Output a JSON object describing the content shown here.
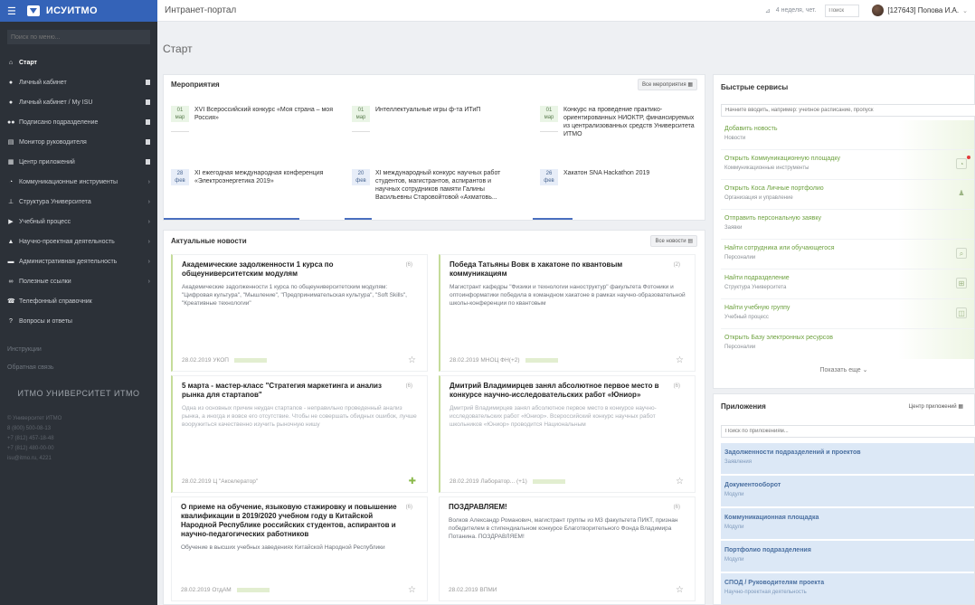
{
  "sidebar": {
    "brand": "ИСУИТМО",
    "search_placeholder": "Поиск по меню...",
    "items": [
      {
        "label": "Старт",
        "active": true,
        "icon": "home-icon"
      },
      {
        "label": "Личный кабинет",
        "icon": "user-icon"
      },
      {
        "label": "Личный кабинет / My ISU",
        "icon": "user-icon"
      },
      {
        "label": "Подписано подразделение",
        "icon": "people-icon"
      },
      {
        "label": "Монитор руководителя",
        "icon": "monitor-icon"
      },
      {
        "label": "Центр приложений",
        "icon": "grid-icon"
      },
      {
        "label": "Коммуникационные инструменты",
        "icon": "chat-icon"
      },
      {
        "label": "Структура Университета",
        "icon": "sitemap-icon"
      },
      {
        "label": "Учебный процесс",
        "icon": "flag-icon"
      },
      {
        "label": "Научно-проектная деятельность",
        "icon": "flask-icon"
      },
      {
        "label": "Административная деятельность",
        "icon": "briefcase-icon"
      },
      {
        "label": "Полезные ссылки",
        "icon": "link-icon"
      },
      {
        "label": "Телефонный справочник",
        "icon": "phone-icon"
      },
      {
        "label": "Вопросы и ответы",
        "icon": "question-icon"
      }
    ],
    "lower": [
      "Инструкции",
      "Обратная связь"
    ],
    "footer_brand": "ИТМО УНИВЕРСИТЕТ ИТМО",
    "footer_lines": [
      "© Университет ИТМО",
      "8 (800) 500-08-13",
      "+7 (812) 457-18-48",
      "+7 (812) 480-00-00",
      "isu@itmo.ru, 4221"
    ]
  },
  "topbar": {
    "title": "Интранет-портал",
    "week": "4 неделя, чет.",
    "search_placeholder": "Поиск",
    "user": "[127643] Попова И.А."
  },
  "page_title": "Старт",
  "events": {
    "title": "Мероприятия",
    "all_label": "Все мероприятия",
    "items": [
      {
        "day": "01",
        "month": "мар",
        "text": "XVI Всероссийский конкурс «Моя страна – моя Россия»"
      },
      {
        "day": "01",
        "month": "мар",
        "text": "Интеллектуальные игры ф-та ИТиП"
      },
      {
        "day": "01",
        "month": "мар",
        "text": "Конкурс на проведение практико-ориентированных НИОКТР, финансируемых из централизованных средств Университета ИТМО"
      },
      {
        "day": "28",
        "month": "фев",
        "text": "XI ежегодная международная конференция «Электроэнергетика 2019»"
      },
      {
        "day": "20",
        "month": "фев",
        "text": "XI международный конкурс научных работ студентов, магистрантов, аспирантов и научных сотрудников памяти Галины Васильевны Старовойтовой «Ахматовь..."
      },
      {
        "day": "26",
        "month": "фев",
        "text": "Хакатон SNA Hackathon 2019"
      }
    ]
  },
  "news": {
    "title": "Актуальные новости",
    "all_label": "Все новости",
    "items": [
      {
        "headline": "Академические задолженности 1 курса по общеуниверситетским модулям",
        "body": "Академические задолженности 1 курса по общеуниверситетским модулям: \"Цифровая культура\", \"Мышление\", \"Предпринимательская культура\", \"Soft Skills\", \"Креативные технологии\"",
        "date": "28.02.2019",
        "source": "УКОП",
        "views": "(6)"
      },
      {
        "headline": "Победа Татьяны Вовк в хакатоне по квантовым коммуникациям",
        "body": "Магистрант кафедры \"Физики и технологии наноструктур\" факультета Фотоники и оптоинформатики победила в командном хакатоне в рамках научно-образовательной школы-конференции по квантовым",
        "date": "28.02.2019",
        "source": "МНОЦ ФН(+2)",
        "views": "(2)"
      },
      {
        "headline": "5 марта - мастер-класс \"Стратегия маркетинга и анализ рынка для стартапов\"",
        "body": "Одна из основных причин неудач стартапов - неправильно проведенный анализ рынка, а иногда и вовсе его отсутствие. Чтобы не совершать обидных ошибок, лучше вооружиться качественно изучить рыночную нишу",
        "date": "28.02.2019",
        "source": "Ц \"Акселератор\"",
        "views": "(6)"
      },
      {
        "headline": "Дмитрий Владимирцев занял абсолютное первое место в конкурсе научно-исследовательских работ «Юниор»",
        "body": "Дмитрий Владимирцев занял абсолютное первое место в конкурсе научно-исследовательских работ «Юниор». Всероссийский конкурс научных работ школьников «Юниор» проводится Национальным",
        "date": "28.02.2019",
        "source": "Лаборатор... (+1)",
        "views": "(6)"
      },
      {
        "headline": "О приеме на обучение, языковую стажировку и повышение квалификации в 2019/2020 учебном году в Китайской Народной Республике российских студентов, аспирантов и научно-педагогических работников",
        "body": "Обучение в высших учебных заведениях Китайской Народной Республики",
        "date": "28.02.2019",
        "source": "ОтдАМ",
        "views": "(6)"
      },
      {
        "headline": "ПОЗДРАВЛЯЕМ!",
        "body": "Волков Александр Романович, магистрант группы из М3 факультета ПИКТ, признан победителем в стипендиальном конкурсе Благотворительного Фонда Владимира Потанина. ПОЗДРАВЛЯЕМ!",
        "date": "28.02.2019",
        "source": "ВПМИ",
        "views": "(6)"
      }
    ]
  },
  "quick": {
    "title": "Быстрые сервисы",
    "search_placeholder": "Начните вводить, например: учебное расписание, пропуск",
    "items": [
      {
        "title": "Добавить новость",
        "sub": "Новости"
      },
      {
        "title": "Открыть Коммуникационную площадку",
        "sub": "Коммуникационные инструменты"
      },
      {
        "title": "Открыть Коса Личные портфолио",
        "sub": "Организация и управление"
      },
      {
        "title": "Отправить персональную заявку",
        "sub": "Заявки"
      },
      {
        "title": "Найти сотрудника или обучающегося",
        "sub": "Персоналии"
      },
      {
        "title": "Найти подразделение",
        "sub": "Структура Университета"
      },
      {
        "title": "Найти учебную группу",
        "sub": "Учебный процесс"
      },
      {
        "title": "Открыть Базу электронных ресурсов",
        "sub": "Персоналии"
      }
    ],
    "more_label": "Показать еще"
  },
  "apps": {
    "title": "Приложения",
    "center_label": "Центр приложений",
    "search_placeholder": "Поиск по приложениям...",
    "items": [
      {
        "title": "Задолженности подразделений и проектов",
        "sub": "Заявления"
      },
      {
        "title": "Документооборот",
        "sub": "Модули"
      },
      {
        "title": "Коммуникационная площадка",
        "sub": "Модули"
      },
      {
        "title": "Портфолио подразделения",
        "sub": "Модули"
      },
      {
        "title": "СПОД / Руководителям проекта",
        "sub": "Научно-проектная деятельность"
      }
    ]
  },
  "colors": {
    "sidebar_bg": "#2c3138",
    "brand_blue": "#3463b8",
    "green_accent": "#6da13e",
    "app_tile": "#dce8f6"
  }
}
